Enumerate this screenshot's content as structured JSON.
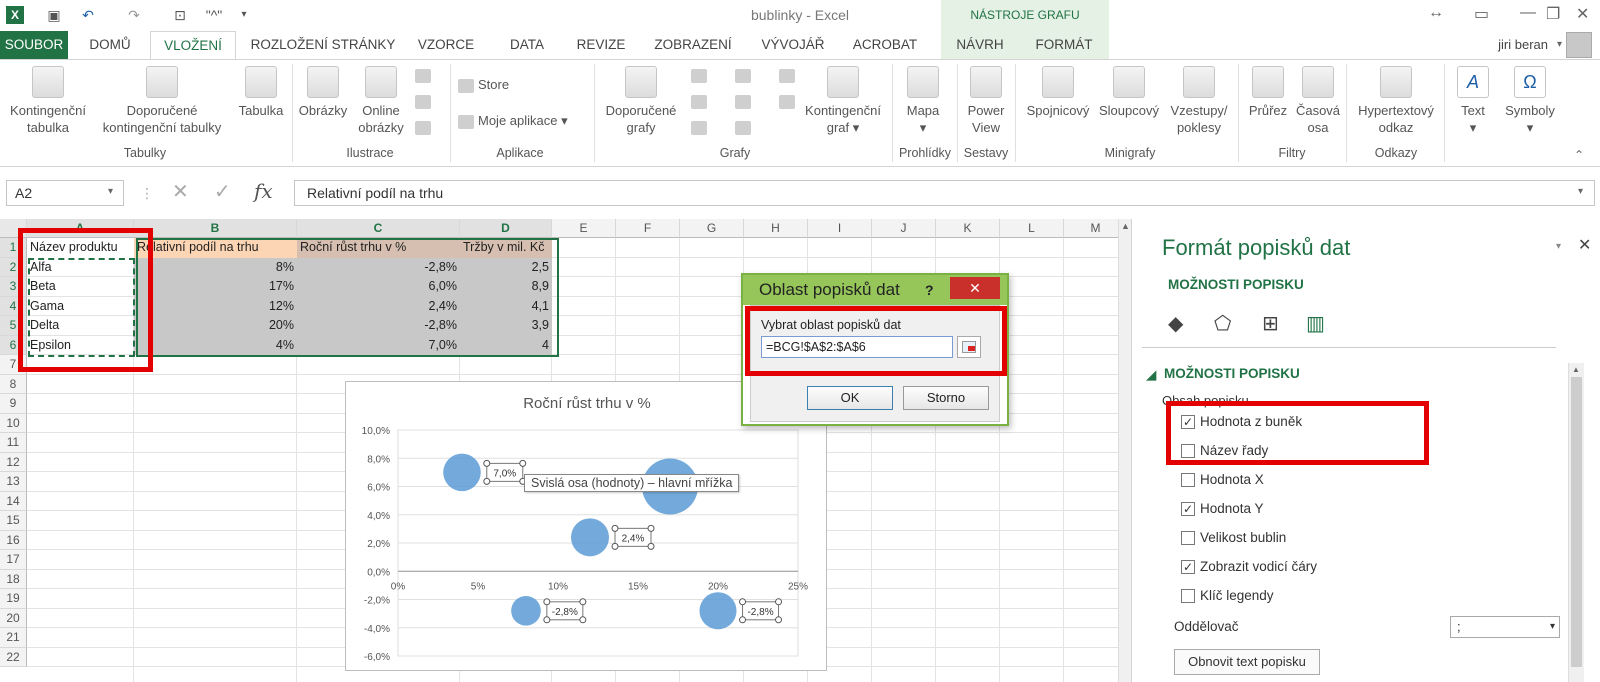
{
  "app": {
    "title": "bublinky - Excel",
    "chart_tools_label": "NÁSTROJE GRAFU",
    "user": "jiri beran"
  },
  "tabs": {
    "file": "SOUBOR",
    "home": "DOMŮ",
    "insert": "VLOŽENÍ",
    "page_layout": "ROZLOŽENÍ STRÁNKY",
    "formulas": "VZORCE",
    "data": "DATA",
    "review": "REVIZE",
    "view": "ZOBRAZENÍ",
    "developer": "VÝVOJÁŘ",
    "acrobat": "ACROBAT",
    "design": "NÁVRH",
    "format": "FORMÁT"
  },
  "ribbon": {
    "pivot_table_1": "Kontingenční",
    "pivot_table_2": "tabulka",
    "rec_pivot_1": "Doporučené",
    "rec_pivot_2": "kontingenční tabulky",
    "table": "Tabulka",
    "pictures": "Obrázky",
    "online_pictures_1": "Online",
    "online_pictures_2": "obrázky",
    "store": "Store",
    "my_apps": "Moje aplikace",
    "rec_charts_1": "Doporučené",
    "rec_charts_2": "grafy",
    "pivot_chart_1": "Kontingenční",
    "pivot_chart_2": "graf",
    "map": "Mapa",
    "power_view_1": "Power",
    "power_view_2": "View",
    "line": "Spojnicový",
    "column": "Sloupcový",
    "winloss_1": "Vzestupy/",
    "winloss_2": "poklesy",
    "slicer": "Průřez",
    "timeline_1": "Časová",
    "timeline_2": "osa",
    "hyperlink_1": "Hypertextový",
    "hyperlink_2": "odkaz",
    "text": "Text",
    "symbols": "Symboly",
    "groups": {
      "tables": "Tabulky",
      "illustrations": "Ilustrace",
      "apps": "Aplikace",
      "charts": "Grafy",
      "tours": "Prohlídky",
      "sparklines_group": "Sestavy",
      "minicharts": "Minigrafy",
      "filters": "Filtry",
      "links": "Odkazy"
    }
  },
  "formula_bar": {
    "name_box": "A2",
    "formula": "Relativní podíl na trhu"
  },
  "sheet": {
    "columns": [
      "A",
      "B",
      "C",
      "D",
      "E",
      "F",
      "G",
      "H",
      "I",
      "J",
      "K",
      "L",
      "M"
    ],
    "rows": [
      "1",
      "2",
      "3",
      "4",
      "5",
      "6",
      "7",
      "8",
      "9",
      "10",
      "11",
      "12",
      "13",
      "14",
      "15",
      "16",
      "17",
      "18",
      "19",
      "20",
      "21",
      "22"
    ],
    "headers": [
      "Název produktu",
      "Relativní podíl na trhu",
      "Roční růst trhu v %",
      "Tržby v mil. Kč"
    ],
    "data": [
      [
        "Alfa",
        "8%",
        "-2,8%",
        "2,5"
      ],
      [
        "Beta",
        "17%",
        "6,0%",
        "8,9"
      ],
      [
        "Gama",
        "12%",
        "2,4%",
        "4,1"
      ],
      [
        "Delta",
        "20%",
        "-2,8%",
        "3,9"
      ],
      [
        "Epsilon",
        "4%",
        "7,0%",
        "4"
      ]
    ]
  },
  "chart_data": {
    "type": "scatter",
    "title": "Roční růst trhu v %",
    "x_ticks": [
      "0%",
      "5%",
      "10%",
      "15%",
      "20%",
      "25%"
    ],
    "y_ticks": [
      "10,0%",
      "8,0%",
      "6,0%",
      "4,0%",
      "2,0%",
      "0,0%",
      "-2,0%",
      "-4,0%",
      "-6,0%"
    ],
    "xlim": [
      0,
      25
    ],
    "ylim": [
      -6,
      10
    ],
    "points": [
      {
        "x": 8,
        "y": -2.8,
        "size": 2.5,
        "label": "-2,8%"
      },
      {
        "x": 17,
        "y": 6.0,
        "size": 8.9,
        "label": ""
      },
      {
        "x": 12,
        "y": 2.4,
        "size": 4.1,
        "label": "2,4%"
      },
      {
        "x": 20,
        "y": -2.8,
        "size": 3.9,
        "label": "-2,8%"
      },
      {
        "x": 4,
        "y": 7.0,
        "size": 4.0,
        "label": "7,0%"
      }
    ],
    "bubble_color": "#5b9bd5",
    "tooltip": "Svislá osa (hodnoty)   – hlavní mřížka"
  },
  "dialog": {
    "title": "Oblast popisků dat",
    "help": "?",
    "close": "✕",
    "label": "Vybrat oblast popisků dat",
    "value": "=BCG!$A$2:$A$6",
    "ok": "OK",
    "cancel": "Storno"
  },
  "pane": {
    "title": "Formát popisků dat",
    "options_header": "MOŽNOSTI POPISKU",
    "section": "MOŽNOSTI POPISKU",
    "content_label": "Obsah popisku",
    "options": [
      {
        "label": "Hodnota z buněk",
        "checked": "✓"
      },
      {
        "label": "Název řady",
        "checked": ""
      },
      {
        "label": "Hodnota X",
        "checked": ""
      },
      {
        "label": "Hodnota Y",
        "checked": "✓"
      },
      {
        "label": "Velikost bublin",
        "checked": ""
      },
      {
        "label": "Zobrazit vodicí čáry",
        "checked": "✓"
      },
      {
        "label": "Klíč legendy",
        "checked": ""
      }
    ],
    "separator_label": "Oddělovač",
    "separator_value": ";",
    "reset_button": "Obnovit text popisku"
  },
  "colors": {
    "excel_green": "#217346",
    "annotation_red": "#e30000",
    "dialog_green": "#96c65a"
  }
}
